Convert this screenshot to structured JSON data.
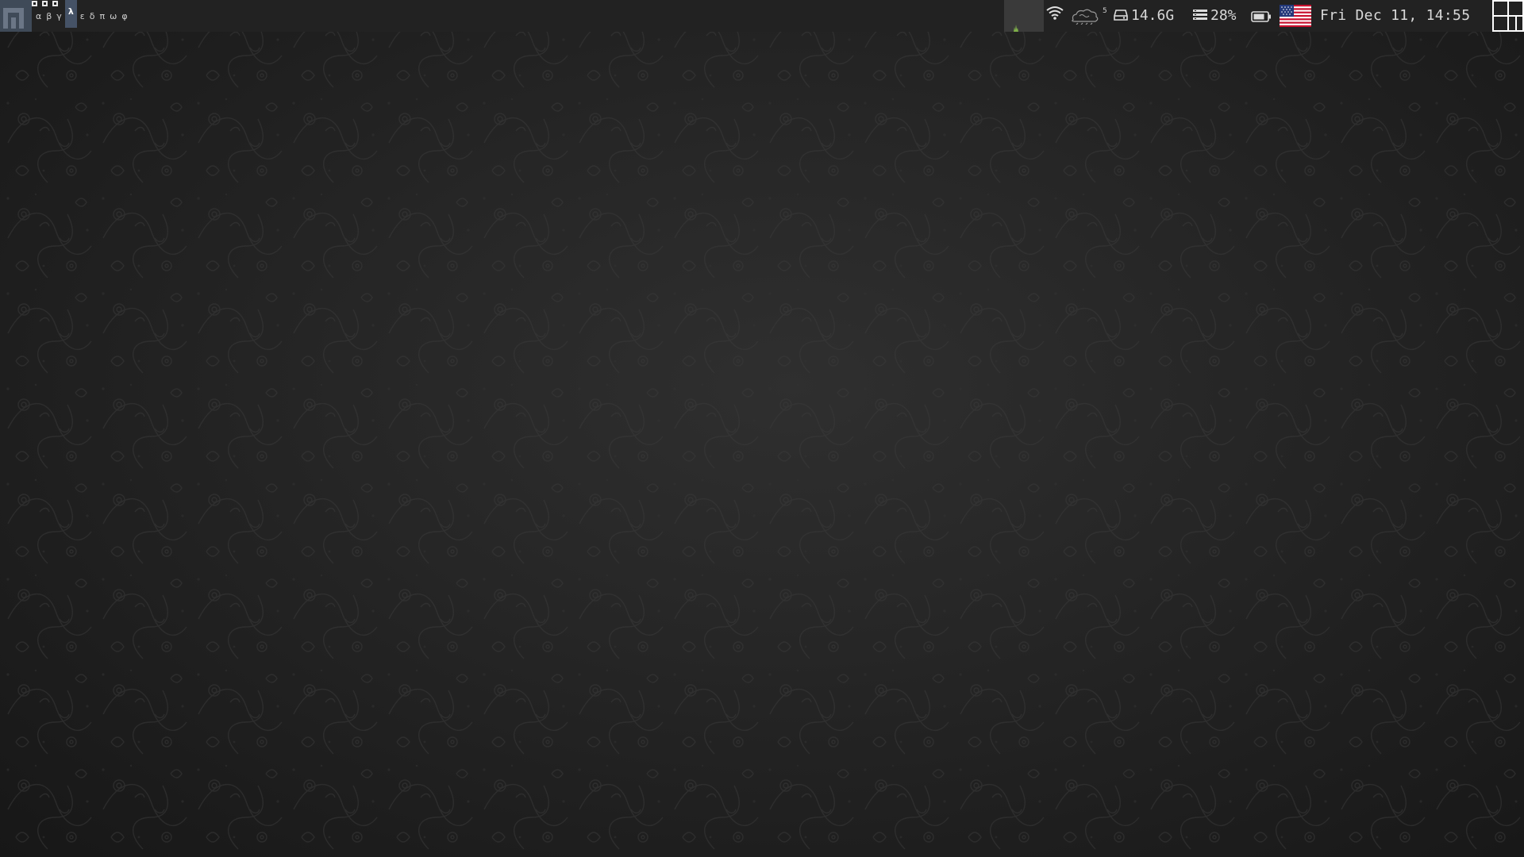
{
  "panel": {
    "workspaces_indicator": [
      "occupied",
      "occupied",
      "occupied"
    ],
    "tags": [
      {
        "label": "α",
        "active": false
      },
      {
        "label": "β",
        "active": false
      },
      {
        "label": "γ",
        "active": false
      },
      {
        "label": "λ",
        "active": true
      },
      {
        "label": "ε",
        "active": false
      },
      {
        "label": "δ",
        "active": false
      },
      {
        "label": "π",
        "active": false
      },
      {
        "label": "ω",
        "active": false
      },
      {
        "label": "φ",
        "active": false
      }
    ],
    "weather_superscript": "5",
    "disk_free": "14.6G",
    "memory_usage": "28%",
    "clock": "Fri Dec 11, 14:55",
    "icons": {
      "logo": "distro-logo-icon",
      "wifi": "wifi-icon",
      "weather": "weather-icon",
      "disk": "disk-icon",
      "memory": "memory-icon",
      "battery": "battery-icon",
      "keyboard_layout": "us-flag-icon",
      "layout": "tile-layout-icon"
    }
  },
  "colors": {
    "panel_bg": "#222222",
    "active_tag_bg": "#455266",
    "logo_bg": "#3f4a58",
    "text": "#dcdcdc"
  }
}
